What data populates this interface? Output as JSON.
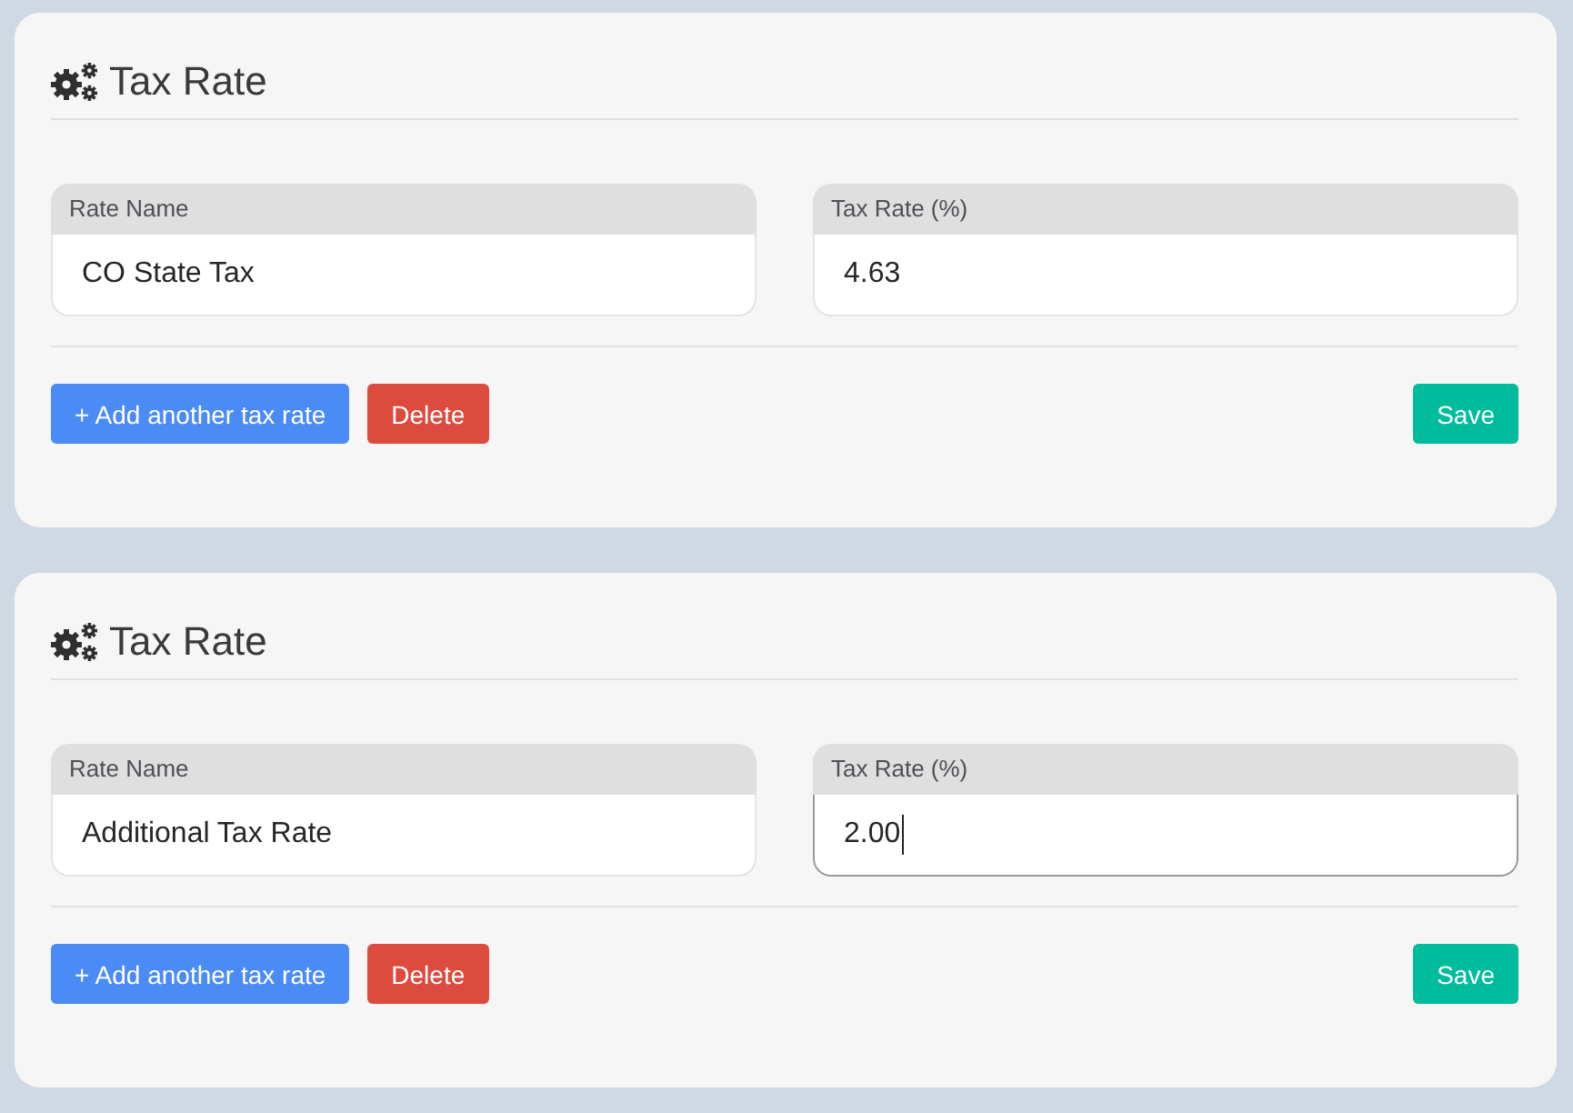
{
  "cards": [
    {
      "title": "Tax Rate",
      "fields": [
        {
          "label": "Rate Name",
          "value": "CO State Tax",
          "focused": false
        },
        {
          "label": "Tax Rate (%)",
          "value": "4.63",
          "focused": false
        }
      ],
      "buttons": [
        {
          "kind": "add",
          "label": "+ Add another tax rate"
        },
        {
          "kind": "delete",
          "label": "Delete"
        },
        {
          "kind": "save",
          "label": "Save"
        }
      ]
    },
    {
      "title": "Tax Rate",
      "fields": [
        {
          "label": "Rate Name",
          "value": "Additional Tax Rate",
          "focused": false
        },
        {
          "label": "Tax Rate (%)",
          "value": "2.00",
          "focused": true
        }
      ],
      "buttons": [
        {
          "kind": "add",
          "label": "+ Add another tax rate"
        },
        {
          "kind": "delete",
          "label": "Delete"
        },
        {
          "kind": "save",
          "label": "Save"
        }
      ]
    }
  ]
}
